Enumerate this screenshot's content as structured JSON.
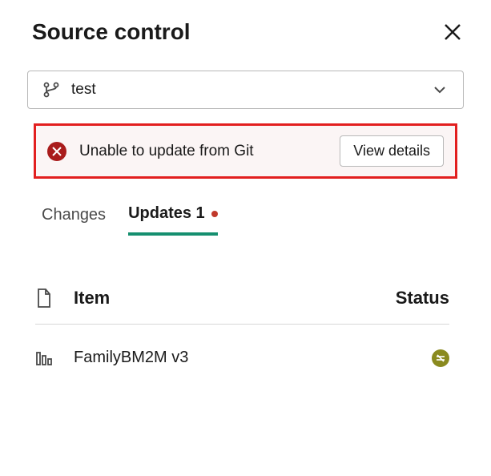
{
  "header": {
    "title": "Source control"
  },
  "branch": {
    "name": "test"
  },
  "error": {
    "message": "Unable to update from Git",
    "button": "View details"
  },
  "tabs": {
    "changes": "Changes",
    "updates": "Updates 1"
  },
  "table": {
    "itemHeader": "Item",
    "statusHeader": "Status",
    "rows": [
      {
        "name": "FamilyBM2M v3"
      }
    ]
  }
}
